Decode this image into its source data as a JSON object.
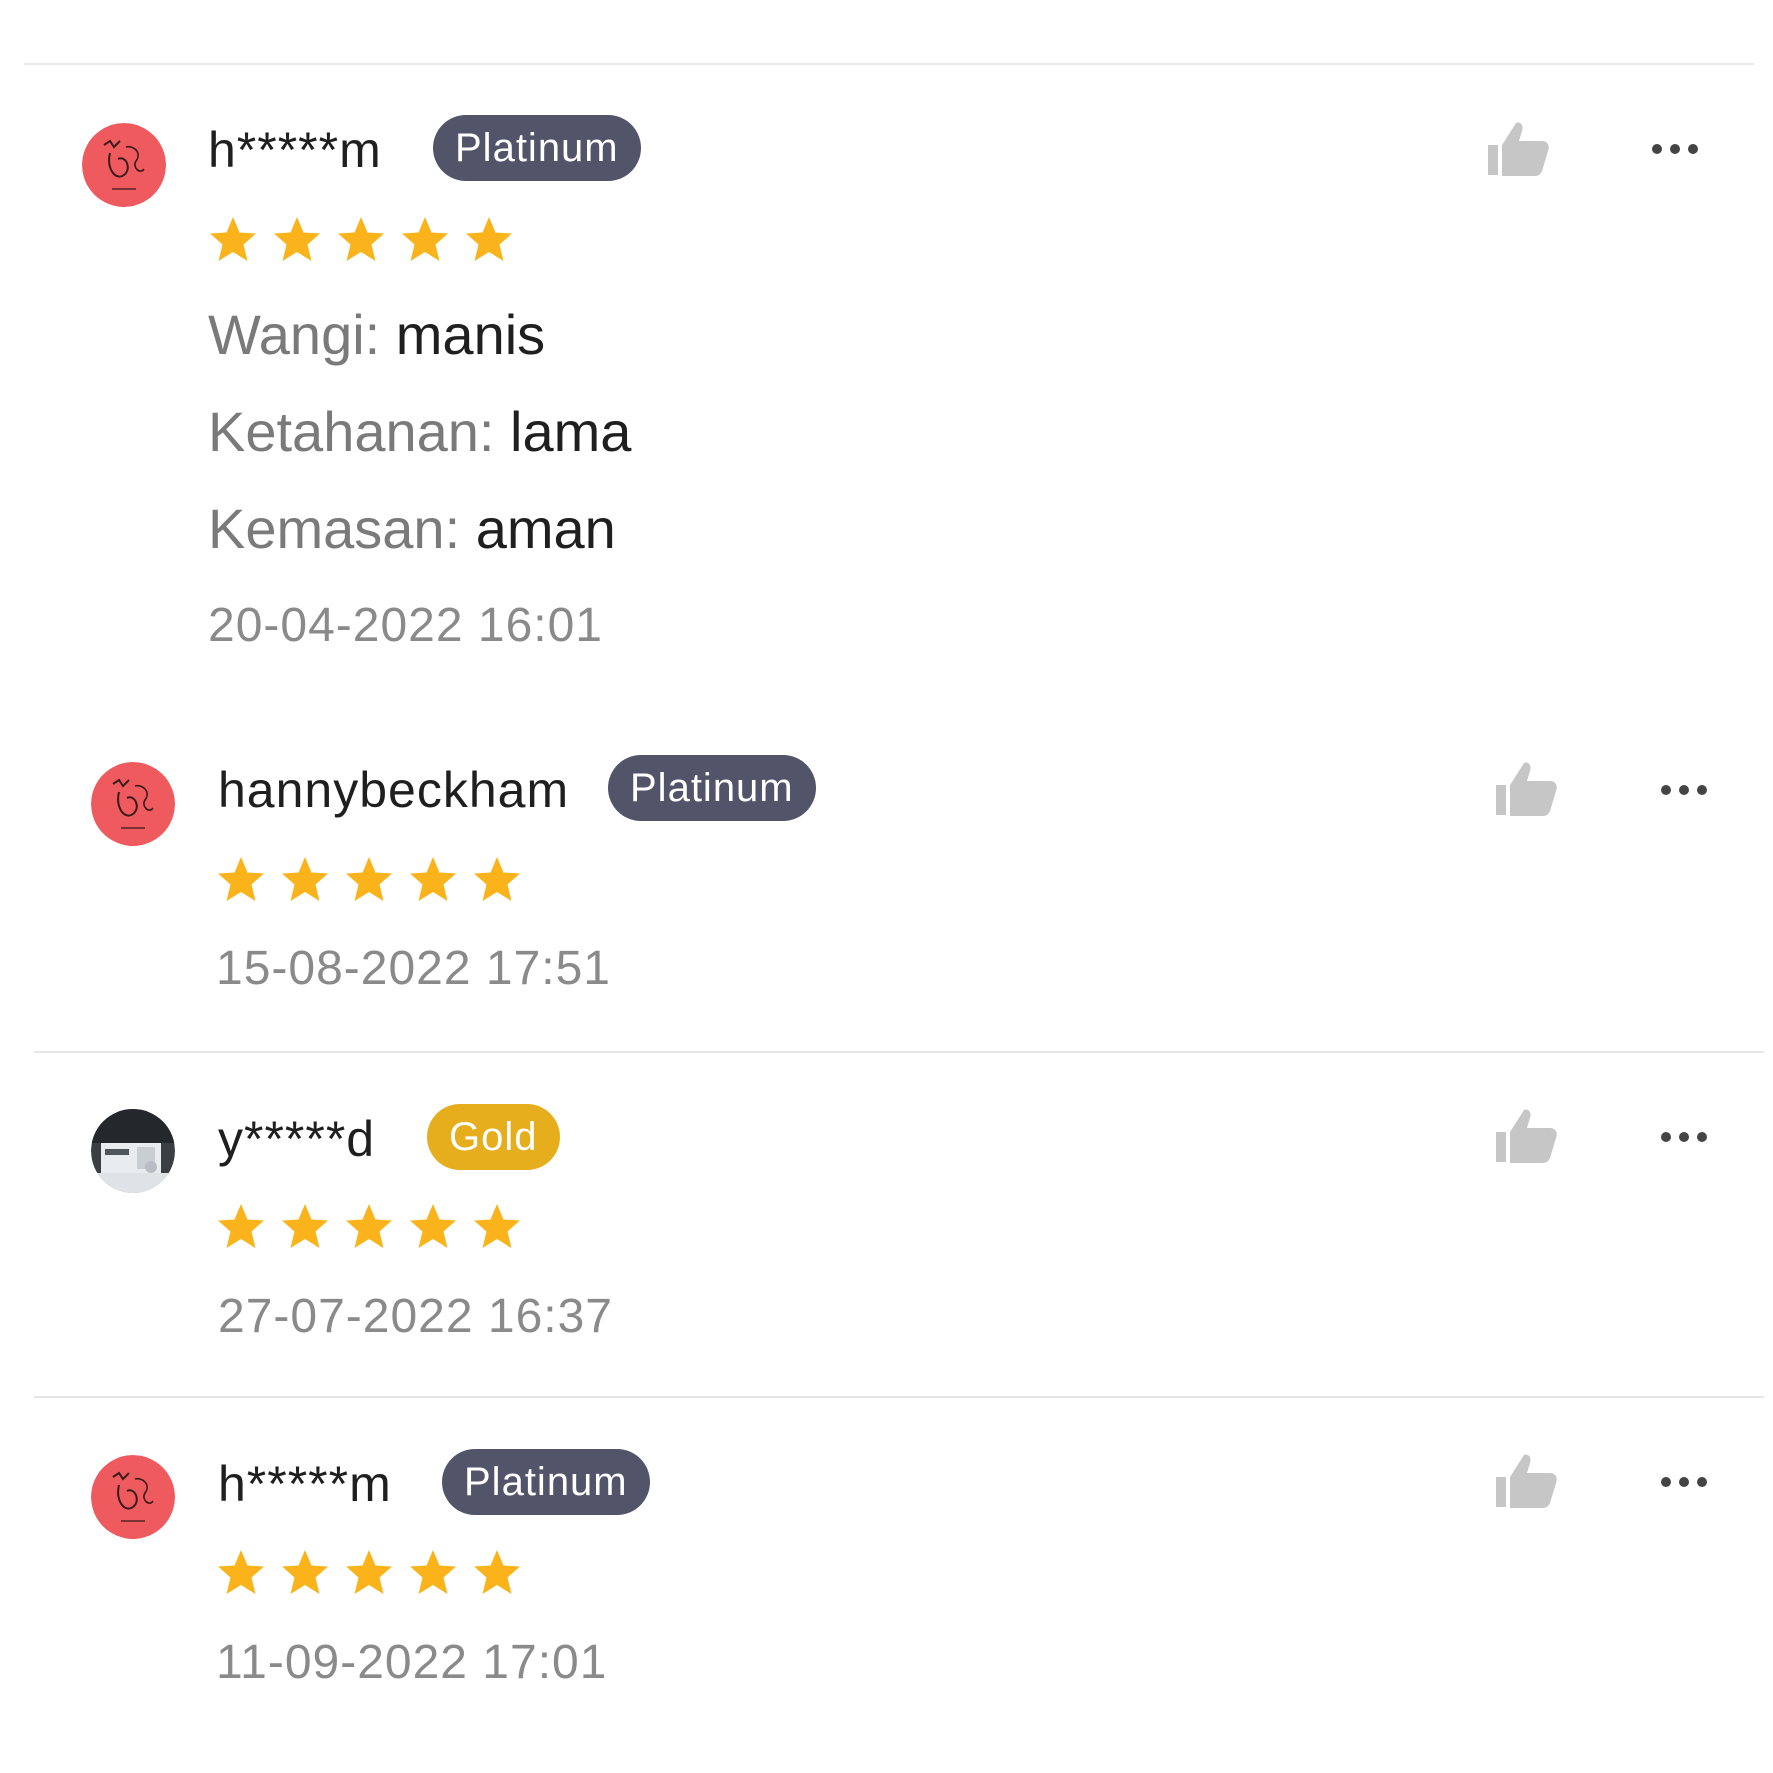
{
  "colors": {
    "platinum_badge": "#52546a",
    "gold_badge": "#e6ae1c",
    "star": "#fbb31c",
    "avatar_pink": "#ee5a5e",
    "like_icon": "#c6c6c6"
  },
  "icons": {
    "like": "thumbs-up-icon",
    "more": "more-horizontal-icon",
    "star": "star-icon"
  },
  "reviews": [
    {
      "username": "h*****m",
      "badge": "Platinum",
      "rating": 5,
      "attributes": [
        {
          "key": "Wangi:",
          "value": "manis"
        },
        {
          "key": "Ketahanan:",
          "value": "lama"
        },
        {
          "key": "Kemasan:",
          "value": "aman"
        }
      ],
      "timestamp": "20-04-2022 16:01"
    },
    {
      "username": "hannybeckham",
      "badge": "Platinum",
      "rating": 5,
      "attributes": [],
      "timestamp": "15-08-2022 17:51"
    },
    {
      "username": "y*****d",
      "badge": "Gold",
      "rating": 5,
      "attributes": [],
      "timestamp": "27-07-2022 16:37"
    },
    {
      "username": "h*****m",
      "badge": "Platinum",
      "rating": 5,
      "attributes": [],
      "timestamp": "11-09-2022 17:01"
    }
  ]
}
